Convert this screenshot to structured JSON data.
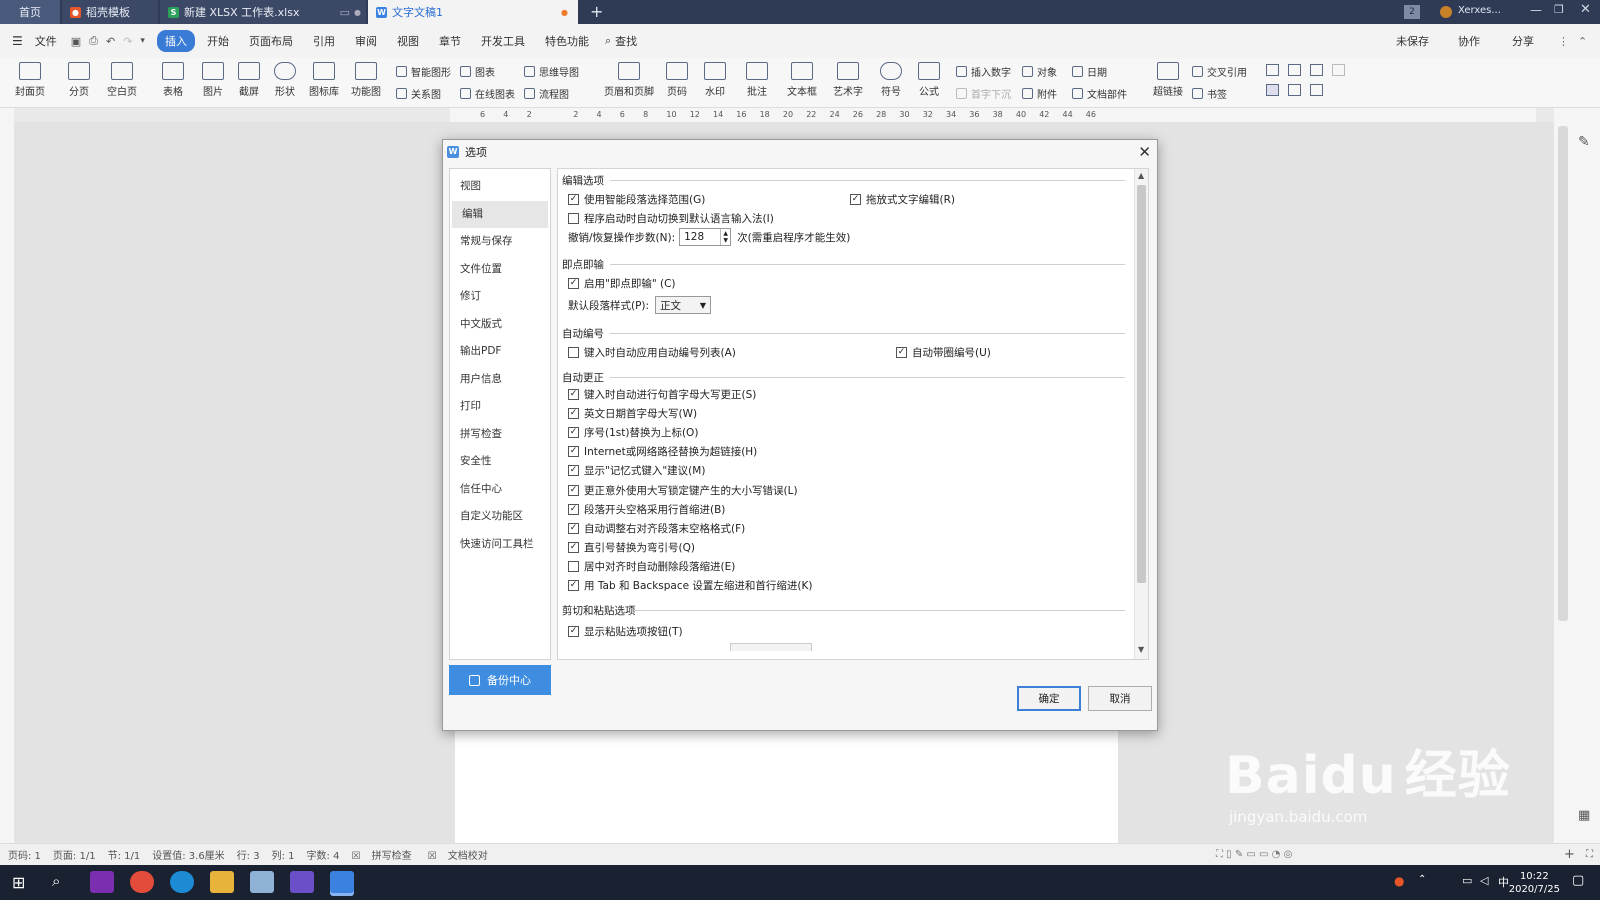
{
  "tabs": [
    {
      "label": "首页"
    },
    {
      "label": "稻壳模板"
    },
    {
      "label": "新建 XLSX 工作表.xlsx"
    },
    {
      "label": "文字文稿1"
    }
  ],
  "titlebar": {
    "user": "Xerxes..."
  },
  "menu": {
    "items": [
      "文件",
      "插入",
      "开始",
      "页面布局",
      "引用",
      "审阅",
      "视图",
      "章节",
      "开发工具",
      "特色功能",
      "查找"
    ],
    "right": [
      "未保存",
      "协作",
      "分享"
    ]
  },
  "ribbon": {
    "items": [
      "封面页",
      "分页",
      "空白页",
      "表格",
      "图片",
      "截屏",
      "形状",
      "图标库",
      "功能图",
      "页眉和页脚",
      "页码",
      "水印",
      "批注",
      "文本框",
      "艺术字",
      "符号",
      "公式",
      "超链接"
    ],
    "small": [
      "智能图形",
      "图表",
      "思维导图",
      "关系图",
      "在线图表",
      "流程图",
      "插入数字",
      "对象",
      "日期",
      "首字下沉",
      "附件",
      "文档部件",
      "交叉引用",
      "书签"
    ]
  },
  "ruler": {
    "ticks": [
      "6",
      "4",
      "2",
      "",
      "2",
      "4",
      "6",
      "8",
      "10",
      "12",
      "14",
      "16",
      "18",
      "20",
      "22",
      "24",
      "26",
      "28",
      "30",
      "32",
      "34",
      "36",
      "38",
      "40",
      "42",
      "44",
      "46"
    ]
  },
  "dialog": {
    "title": "选项",
    "nav": [
      "视图",
      "编辑",
      "常规与保存",
      "文件位置",
      "修订",
      "中文版式",
      "输出PDF",
      "用户信息",
      "打印",
      "拼写检查",
      "安全性",
      "信任中心",
      "自定义功能区",
      "快速访问工具栏"
    ],
    "backup_label": "备份中心",
    "sections": {
      "edit": "编辑选项",
      "click_type": "即点即输",
      "auto_number": "自动编号",
      "auto_correct": "自动更正",
      "cut_paste": "剪切和粘贴选项"
    },
    "edit": {
      "smart_select": "使用智能段落选择范围(G)",
      "drag_drop": "拖放式文字编辑(R)",
      "auto_ime": "程序启动时自动切换到默认语言输入法(I)",
      "undo_label": "撤销/恢复操作步数(N):",
      "undo_value": "128",
      "undo_note": "次(需重启程序才能生效)"
    },
    "click_type": {
      "enable": "启用\"即点即输\" (C)",
      "para_style_label": "默认段落样式(P):",
      "para_style_value": "正文"
    },
    "auto_number": {
      "auto_list": "键入时自动应用自动编号列表(A)",
      "circle": "自动带圈编号(U)"
    },
    "auto_correct": [
      {
        "label": "键入时自动进行句首字母大写更正(S)",
        "checked": true
      },
      {
        "label": "英文日期首字母大写(W)",
        "checked": true
      },
      {
        "label": "序号(1st)替换为上标(O)",
        "checked": true
      },
      {
        "label": "Internet或网络路径替换为超链接(H)",
        "checked": true
      },
      {
        "label": "显示\"记忆式键入\"建议(M)",
        "checked": true
      },
      {
        "label": "更正意外使用大写锁定键产生的大小写错误(L)",
        "checked": true
      },
      {
        "label": "段落开头空格采用行首缩进(B)",
        "checked": true
      },
      {
        "label": "自动调整右对齐段落末空格格式(F)",
        "checked": true
      },
      {
        "label": "直引号替换为弯引号(Q)",
        "checked": true
      },
      {
        "label": "居中对齐时自动删除段落缩进(E)",
        "checked": false
      },
      {
        "label": "用 Tab 和 Backspace 设置左缩进和首行缩进(K)",
        "checked": true
      }
    ],
    "cut_paste": {
      "show_btn": "显示粘贴选项按钮(T)"
    },
    "ok": "确定",
    "cancel": "取消"
  },
  "status": [
    "页码: 1",
    "页面: 1/1",
    "节: 1/1",
    "设置值: 3.6厘米",
    "行: 3",
    "列: 1",
    "字数: 4",
    "拼写检查",
    "文档校对"
  ],
  "taskbar": {
    "time": "10:22",
    "date": "2020/7/25",
    "ime": "中"
  },
  "watermark": {
    "brand": "Baidu",
    "cn": "经验",
    "url": "jingyan.baidu.com"
  },
  "colors": {
    "accent": "#3a7bd5",
    "tabbar": "#2f3b55",
    "backup": "#3f8de0"
  }
}
